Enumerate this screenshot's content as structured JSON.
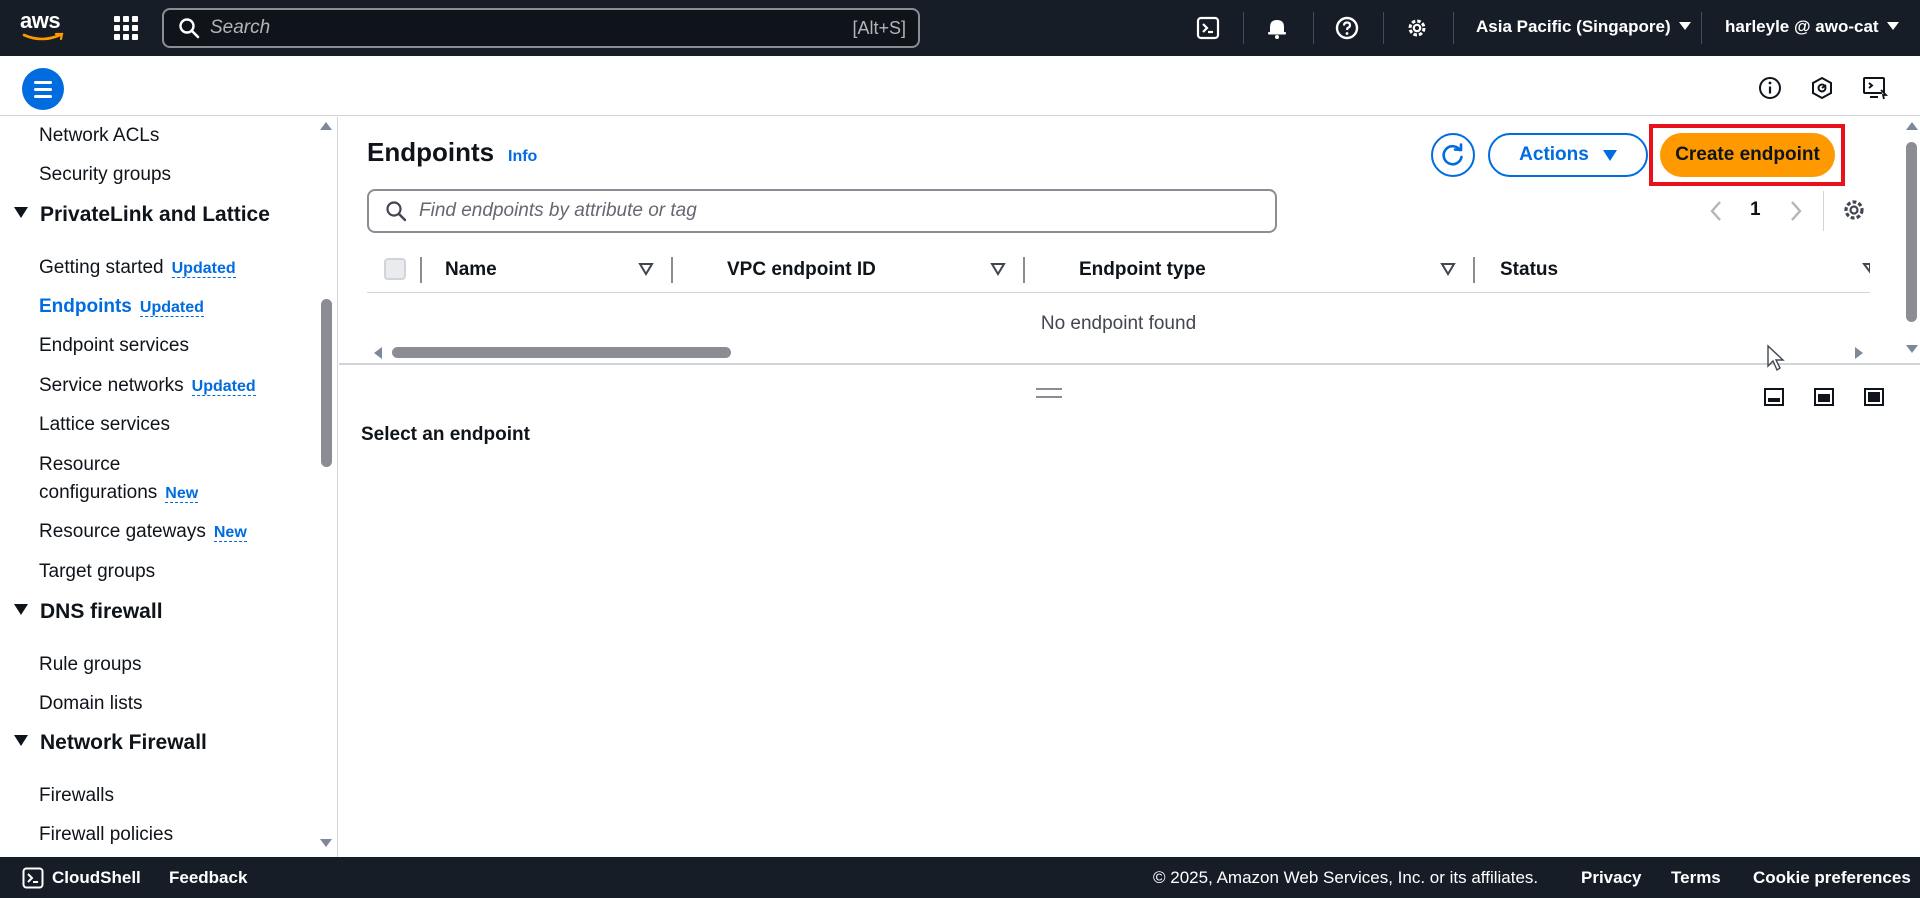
{
  "topnav": {
    "logo_text": "aws",
    "search": {
      "placeholder": "Search",
      "shortcut": "[Alt+S]"
    },
    "region": "Asia Pacific (Singapore)",
    "account": "harleyle @ awo-cat"
  },
  "sidebar": {
    "items": [
      {
        "label": "Network ACLs"
      },
      {
        "label": "Security groups"
      },
      {
        "section": "PrivateLink and Lattice"
      },
      {
        "label": "Getting started",
        "badge": "Updated"
      },
      {
        "label": "Endpoints",
        "badge": "Updated",
        "active": true
      },
      {
        "label": "Endpoint services"
      },
      {
        "label": "Service networks",
        "badge": "Updated"
      },
      {
        "label": "Lattice services"
      },
      {
        "label": "Resource configurations",
        "line1": "Resource",
        "line2": "configurations",
        "badge": "New"
      },
      {
        "label": "Resource gateways",
        "badge": "New"
      },
      {
        "label": "Target groups"
      },
      {
        "section": "DNS firewall"
      },
      {
        "label": "Rule groups"
      },
      {
        "label": "Domain lists"
      },
      {
        "section": "Network Firewall"
      },
      {
        "label": "Firewalls"
      },
      {
        "label": "Firewall policies"
      }
    ]
  },
  "main": {
    "title": "Endpoints",
    "info": "Info",
    "actions_label": "Actions",
    "create_label": "Create endpoint",
    "filter_placeholder": "Find endpoints by attribute or tag",
    "page_number": "1",
    "columns": [
      "Name",
      "VPC endpoint ID",
      "Endpoint type",
      "Status"
    ],
    "empty_text": "No endpoint found",
    "detail_title": "Select an endpoint"
  },
  "footer": {
    "cloudshell": "CloudShell",
    "feedback": "Feedback",
    "copyright": "© 2025, Amazon Web Services, Inc. or its affiliates.",
    "privacy": "Privacy",
    "terms": "Terms",
    "cookies": "Cookie preferences"
  },
  "colors": {
    "nav_bg": "#161d26",
    "link_blue": "#006ce0",
    "primary_orange": "#ff9900",
    "highlight_red": "#e8121b"
  }
}
